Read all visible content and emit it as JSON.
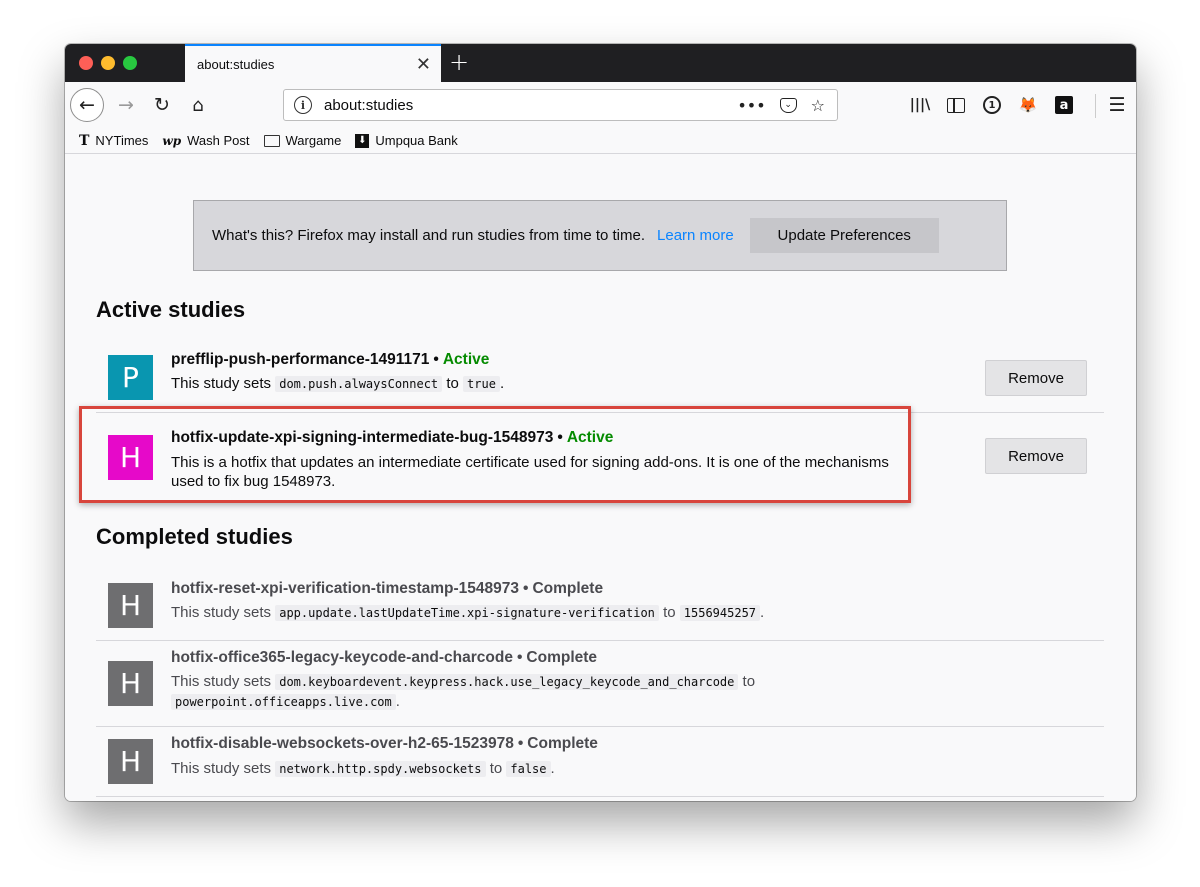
{
  "tab": {
    "title": "about:studies",
    "close": "✕",
    "new_tab": "+"
  },
  "nav": {
    "back": "←",
    "forward": "→",
    "reload": "↻",
    "home": "⌂",
    "url": "about:studies",
    "page_actions": "•••",
    "star": "☆",
    "library": "|||\\",
    "menu": "☰"
  },
  "bookmarks": [
    {
      "label": "NYTimes",
      "icon": "T"
    },
    {
      "label": "Wash Post",
      "icon": "wp"
    },
    {
      "label": "Wargame",
      "icon": "folder-icon"
    },
    {
      "label": "Umpqua Bank",
      "icon": "bank-icon"
    }
  ],
  "banner": {
    "text": "What's this? Firefox may install and run studies from time to time.",
    "learn_more": "Learn more",
    "button": "Update Preferences"
  },
  "active": {
    "title": "Active studies",
    "studies": [
      {
        "letter": "P",
        "color": "#0996b0",
        "name": "prefflip-push-performance-1491171",
        "status": "Active",
        "desc_prefix": "This study sets",
        "pref": "dom.push.alwaysConnect",
        "to": "to",
        "value": "true",
        "end": ".",
        "remove": "Remove"
      },
      {
        "letter": "H",
        "color": "#e609c9",
        "name": "hotfix-update-xpi-signing-intermediate-bug-1548973",
        "status": "Active",
        "desc": "This is a hotfix that updates an intermediate certificate used for signing add-ons. It is one of the mechanisms used to fix bug 1548973.",
        "remove": "Remove"
      }
    ]
  },
  "completed": {
    "title": "Completed studies",
    "studies": [
      {
        "letter": "H",
        "color": "#6e6e70",
        "name": "hotfix-reset-xpi-verification-timestamp-1548973",
        "status": "Complete",
        "desc_prefix": "This study sets",
        "pref": "app.update.lastUpdateTime.xpi-signature-verification",
        "to": "to",
        "value": "1556945257",
        "end": "."
      },
      {
        "letter": "H",
        "color": "#6e6e70",
        "name": "hotfix-office365-legacy-keycode-and-charcode",
        "status": "Complete",
        "desc_prefix": "This study sets",
        "pref": "dom.keyboardevent.keypress.hack.use_legacy_keycode_and_charcode",
        "to": "to",
        "value": "powerpoint.officeapps.live.com",
        "end": "."
      },
      {
        "letter": "H",
        "color": "#6e6e70",
        "name": "hotfix-disable-websockets-over-h2-65-1523978",
        "status": "Complete",
        "desc_prefix": "This study sets",
        "pref": "network.http.spdy.websockets",
        "to": "to",
        "value": "false",
        "end": "."
      }
    ]
  },
  "separator": "•"
}
